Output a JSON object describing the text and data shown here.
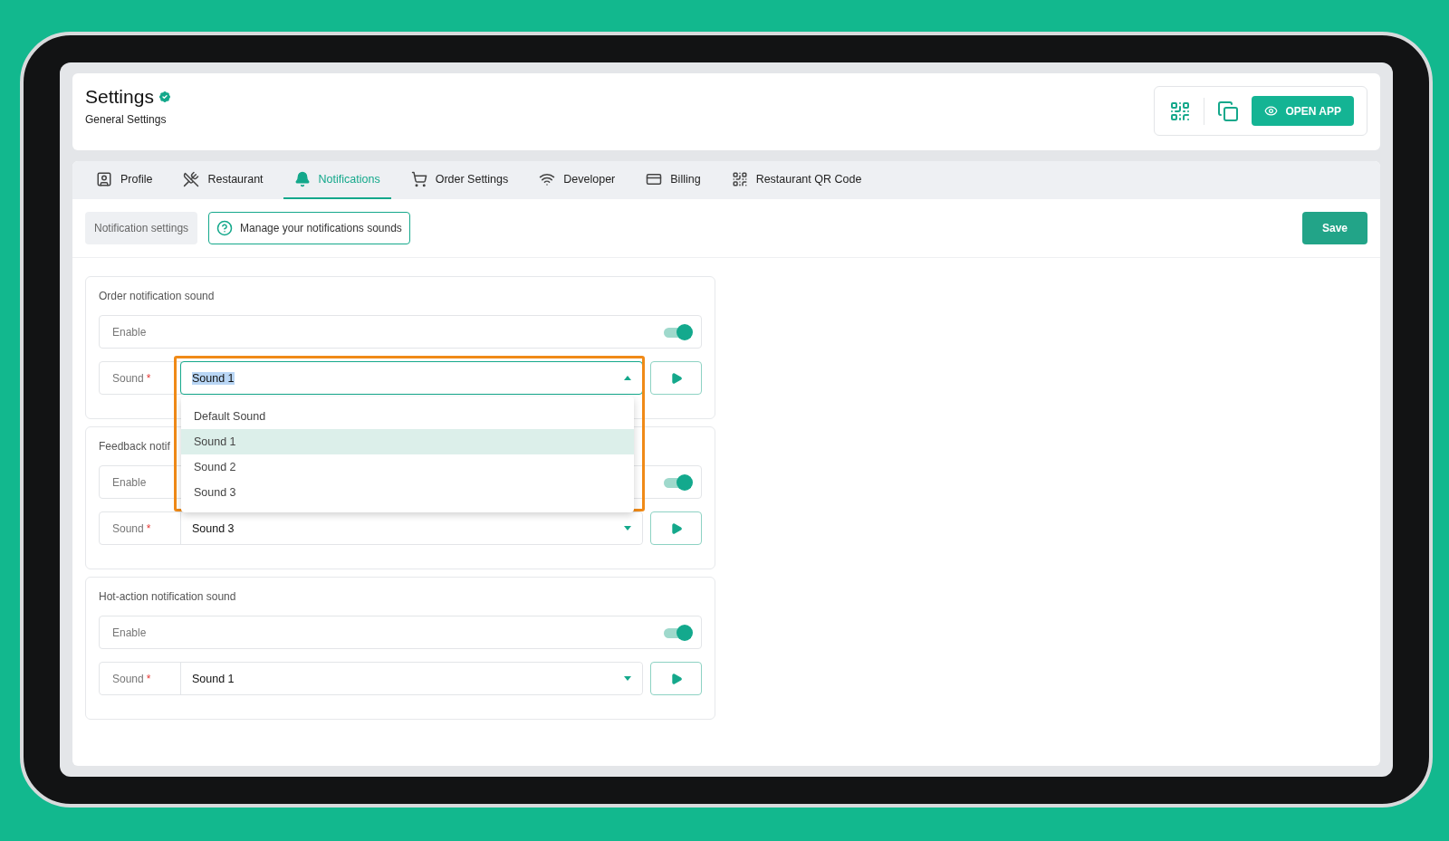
{
  "header": {
    "title": "Settings",
    "subtitle": "General Settings",
    "open_app": "OPEN APP"
  },
  "tabs": [
    {
      "label": "Profile",
      "selected": false
    },
    {
      "label": "Restaurant",
      "selected": false
    },
    {
      "label": "Notifications",
      "selected": true
    },
    {
      "label": "Order Settings",
      "selected": false
    },
    {
      "label": "Developer",
      "selected": false
    },
    {
      "label": "Billing",
      "selected": false
    },
    {
      "label": "Restaurant QR Code",
      "selected": false
    }
  ],
  "subbar": {
    "section_label": "Notification settings",
    "hint": "Manage your notifications sounds",
    "save": "Save"
  },
  "sections": [
    {
      "title": "Order notification sound",
      "enable_label": "Enable",
      "enabled": true,
      "sound_label": "Sound",
      "required_mark": "*",
      "sound_value": "Sound 1",
      "expanded": true,
      "options": [
        {
          "label": "Default Sound",
          "selected": false
        },
        {
          "label": "Sound 1",
          "selected": true
        },
        {
          "label": "Sound 2",
          "selected": false
        },
        {
          "label": "Sound 3",
          "selected": false
        }
      ]
    },
    {
      "title": "Feedback notif",
      "enable_label": "Enable",
      "enabled": true,
      "sound_label": "Sound",
      "required_mark": "*",
      "sound_value": "Sound 3",
      "expanded": false
    },
    {
      "title": "Hot-action notification sound",
      "enable_label": "Enable",
      "enabled": true,
      "sound_label": "Sound",
      "required_mark": "*",
      "sound_value": "Sound 1",
      "expanded": false
    }
  ]
}
